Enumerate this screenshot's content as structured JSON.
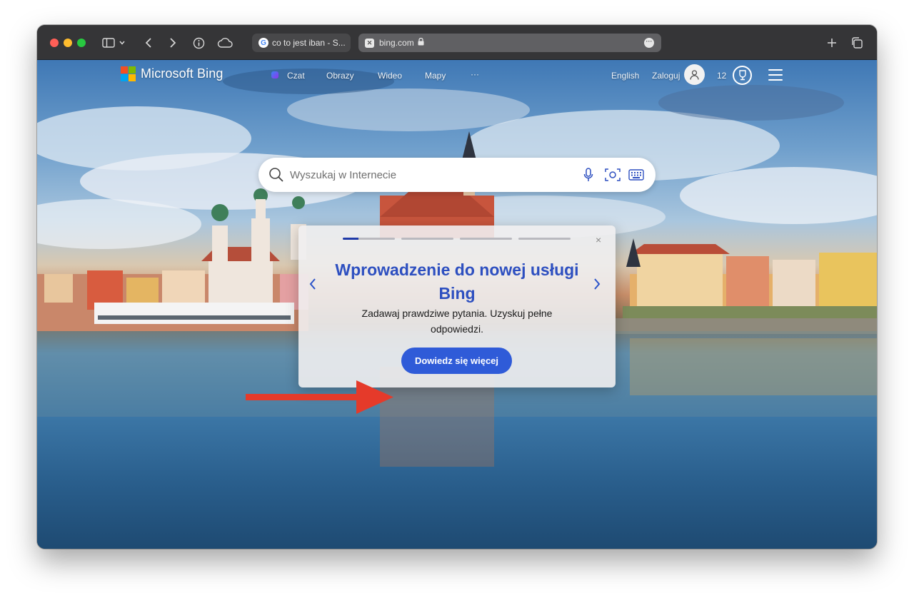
{
  "browser": {
    "tabs": [
      {
        "title": "co to jest iban - S...",
        "favicon": "google-icon"
      },
      {
        "title": "bing.com",
        "favicon": "bing-tab-icon",
        "secure": true
      }
    ],
    "icons": [
      "sidebar-icon",
      "chevron-down-icon",
      "back-icon",
      "forward-icon",
      "info-icon",
      "cloud-icon",
      "new-tab-icon",
      "tab-overview-icon"
    ],
    "traffic_colors": [
      "#ff5f57",
      "#febc2e",
      "#28c840"
    ]
  },
  "header": {
    "logo": "Microsoft Bing",
    "nav": [
      "Czat",
      "Obrazy",
      "Wideo",
      "Mapy",
      "···"
    ],
    "language": "English",
    "signin": "Zaloguj",
    "rewards_count": "12"
  },
  "search": {
    "placeholder": "Wyszukaj w Internecie"
  },
  "promo": {
    "title": "Wprowadzenie do nowej usługi Bing",
    "subtitle": "Zadawaj prawdziwe pytania. Uzyskuj pełne odpowiedzi.",
    "button": "Dowiedz się więcej",
    "steps_total": 4,
    "step_active": 1,
    "close": "×"
  },
  "colors": {
    "accent": "#2f5bd8",
    "promo_title": "#2d4fc0",
    "annotation_arrow": "#e53a2a"
  }
}
